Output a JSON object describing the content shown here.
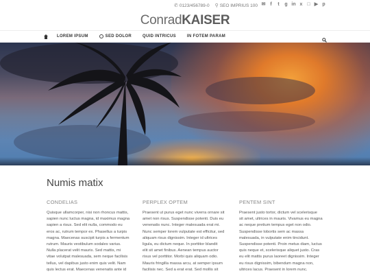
{
  "topbar": {
    "phone": "0123/456789-0",
    "address": "SEO IMPRIUS 100",
    "social_icons": [
      "mail-icon",
      "facebook-icon",
      "twitter-icon",
      "google-plus-icon",
      "linkedin-icon",
      "xing-icon",
      "instagram-icon",
      "youtube-icon",
      "pinterest-icon"
    ]
  },
  "logo": {
    "part1": "Conrad",
    "part2": "KAISER"
  },
  "nav": {
    "items": [
      {
        "label": "LOREM IPSUM"
      },
      {
        "label": "SED DOLOR"
      },
      {
        "label": "QUID INTRICUS"
      },
      {
        "label": "IN FOTEM PARAM"
      }
    ]
  },
  "main": {
    "title": "Numis matix",
    "columns": [
      {
        "heading": "CONDELIAS",
        "lines": [
          "Quisque ullamcorper, nisi non rhoncus mattis,",
          "sapien nunc luctus magna, id maximus magna",
          "sapien a risus. Sed elit nulla, commodo eu",
          "eros ac, rutrum tempor ex. Phasellus a turpis",
          "magna. Maecenas suscipit turpis a fermentum",
          "rutrum. Mauris vestibulum sodales varius.",
          "Nulla placerat velit mauris. Sed mattis, mi",
          "vitae volutpat malesuada, sem neque facilisis",
          "tellus, vel dapibus justo enim quis velit. Nam",
          "quis lectus erat. Maecenas venenatis ante id"
        ]
      },
      {
        "heading": "PERPLEX OPTEM",
        "lines": [
          "Praesent ut purus eget nunc viverra ornare sit",
          "amet non risus. Suspendisse potenti. Duis eu",
          "venenatis nunc. Integer malesuada erat mi.",
          "Nunc semper lorem vulputate est efficitur, sed",
          "aliquam risus dignissim. Integer id ultrices",
          "ligula, eu dictum neque. In porttitor blandit",
          "elit sit amet finibus. Aenean tempus auctor",
          "risus vel porttitor. Morbi quis aliquam odio.",
          "Mauris fringilla massa arcu, at semper ipsum",
          "facilisis nec. Sed a erat erat. Sed mollis sit"
        ]
      },
      {
        "heading": "PENTEM SINT",
        "lines": [
          "Praesent justo tortor, dictum vel scelerisque",
          "sit amet, ultrices in mauris. Vivamus eu magna",
          "ac neque pretium tempus eget non odio.",
          "Suspendisse lobortis sem ac massa",
          "malesuada, in vulputate enim tincidunt.",
          "Suspendisse potenti. Proin metus diam, luctus",
          "quis neque et, scelerisque aliquet justo. Cras",
          "eu elit mattis purus laoreet dignissim. Integer",
          "eu risus dignissim, bibendum magna non,",
          "ultrices lacus. Praesent in lorem nunc."
        ]
      }
    ]
  }
}
